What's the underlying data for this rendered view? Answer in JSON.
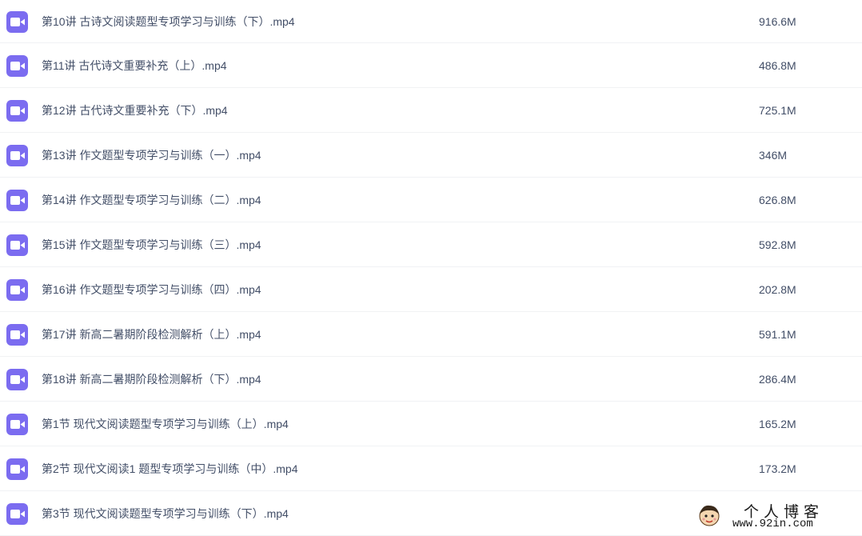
{
  "files": [
    {
      "name": "第10讲 古诗文阅读题型专项学习与训练（下）.mp4",
      "size": "916.6M",
      "icon": "video-file-icon"
    },
    {
      "name": "第11讲 古代诗文重要补充（上）.mp4",
      "size": "486.8M",
      "icon": "video-file-icon"
    },
    {
      "name": "第12讲 古代诗文重要补充（下）.mp4",
      "size": "725.1M",
      "icon": "video-file-icon"
    },
    {
      "name": "第13讲 作文题型专项学习与训练（一）.mp4",
      "size": "346M",
      "icon": "video-file-icon"
    },
    {
      "name": "第14讲 作文题型专项学习与训练（二）.mp4",
      "size": "626.8M",
      "icon": "video-file-icon"
    },
    {
      "name": "第15讲 作文题型专项学习与训练（三）.mp4",
      "size": "592.8M",
      "icon": "video-file-icon"
    },
    {
      "name": "第16讲 作文题型专项学习与训练（四）.mp4",
      "size": "202.8M",
      "icon": "video-file-icon"
    },
    {
      "name": "第17讲 新高二暑期阶段检测解析（上）.mp4",
      "size": "591.1M",
      "icon": "video-file-icon"
    },
    {
      "name": "第18讲 新高二暑期阶段检测解析（下）.mp4",
      "size": "286.4M",
      "icon": "video-file-icon"
    },
    {
      "name": "第1节 现代文阅读题型专项学习与训练（上）.mp4",
      "size": "165.2M",
      "icon": "video-file-icon"
    },
    {
      "name": "第2节 现代文阅读1 题型专项学习与训练（中）.mp4",
      "size": "173.2M",
      "icon": "video-file-icon"
    },
    {
      "name": "第3节 现代文阅读题型专项学习与训练（下）.mp4",
      "size": "",
      "icon": "video-file-icon"
    }
  ],
  "watermark": {
    "title": "个人博客",
    "url": "www.92in.com"
  },
  "colors": {
    "icon_bg": "#7b6cf0",
    "text": "#424e67",
    "row_divider": "#f1f2f4"
  }
}
